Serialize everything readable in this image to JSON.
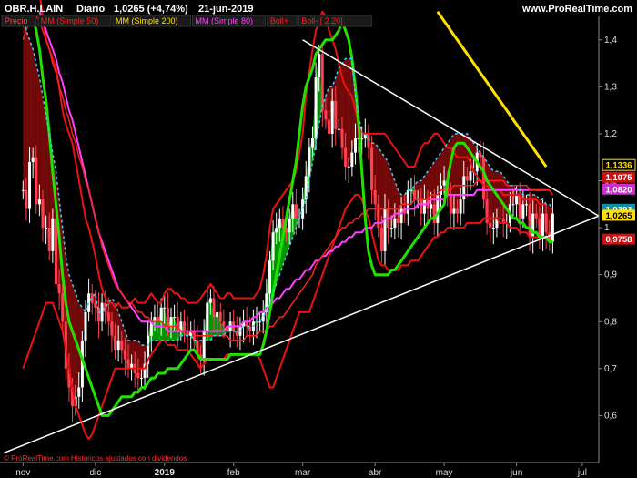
{
  "header": {
    "symbol": "OBR.H.LAIN",
    "period": "Diario",
    "price_change": "1,0265 (+4,74%)",
    "date": "21-jun-2019",
    "site": "www.ProRealTime.com"
  },
  "legend": [
    {
      "label": "Precio",
      "color": "#ff4040",
      "bg": "#1a1a1a"
    },
    {
      "label": "MM (Simple 50)",
      "color": "#ff2020",
      "bg": "#1a1a1a"
    },
    {
      "label": "MM (Simple 200)",
      "color": "#ffe000",
      "bg": "#1a1a1a"
    },
    {
      "label": "MM (Simple 80)",
      "color": "#ff40ff",
      "bg": "#1a1a1a"
    },
    {
      "label": "Boll+",
      "color": "#ff2020",
      "bg": "#1a1a1a"
    },
    {
      "label": "Boll-  [ 2.20]",
      "color": "#ff2020",
      "bg": "#1a1a1a"
    }
  ],
  "footer": "© ProRealTime.com  Históricos ajustados con dividendos",
  "colors": {
    "background": "#000000",
    "up_candle": "#ffffff",
    "down_candle": "#ff4050",
    "sar": "#39d0ff",
    "boll": "#ee1111",
    "ma50": "#ff2020",
    "ma200": "#ffe000",
    "ma80": "#ff40ff",
    "bull_cloud": "#00a000",
    "bear_cloud": "#7a0a0a",
    "green_line": "#22e000",
    "trendline": "#ffffff"
  },
  "price_badges": [
    {
      "value": "1,1336",
      "bg": "#000000",
      "fg": "#ffe000",
      "border": "#ffe000"
    },
    {
      "value": "1,1075",
      "bg": "#cc1010",
      "fg": "#ffffff"
    },
    {
      "value": "1,0820",
      "bg": "#cc30cc",
      "fg": "#ffffff"
    },
    {
      "value": "1,0393",
      "bg": "#1090a0",
      "fg": "#ffffff"
    },
    {
      "value": "1,0265",
      "bg": "#ffe000",
      "fg": "#000000"
    },
    {
      "value": "0,9758",
      "bg": "#cc1010",
      "fg": "#ffffff"
    }
  ],
  "chart_data": {
    "type": "line",
    "title": "",
    "ylim": [
      0.5,
      1.45
    ],
    "y_ticks": [
      "1,4",
      "1,3",
      "1,2",
      "1,1",
      "1",
      "0,9",
      "0,8",
      "0,7",
      "0,6"
    ],
    "y_tick_values": [
      1.4,
      1.3,
      1.2,
      1.1,
      1.0,
      0.9,
      0.8,
      0.7,
      0.6
    ],
    "x_ticks": [
      "nov",
      "dic",
      "2019",
      "feb",
      "mar",
      "abr",
      "may",
      "jun",
      "jul"
    ],
    "x_tick_values": [
      0,
      22,
      43,
      64,
      85,
      107,
      128,
      150,
      170
    ],
    "xlim": [
      -7,
      175
    ],
    "grid": false,
    "close": [
      1.08,
      1.04,
      1.14,
      1.15,
      1.05,
      1.06,
      1.0,
      1.0,
      0.95,
      1.02,
      0.88,
      0.86,
      0.8,
      0.7,
      0.66,
      0.62,
      0.64,
      0.66,
      0.76,
      0.82,
      0.86,
      0.84,
      0.83,
      0.8,
      0.84,
      0.82,
      0.8,
      0.77,
      0.74,
      0.76,
      0.74,
      0.72,
      0.7,
      0.71,
      0.69,
      0.68,
      0.68,
      0.71,
      0.77,
      0.8,
      0.81,
      0.8,
      0.83,
      0.83,
      0.79,
      0.81,
      0.81,
      0.78,
      0.8,
      0.78,
      0.77,
      0.78,
      0.76,
      0.73,
      0.72,
      0.78,
      0.84,
      0.85,
      0.81,
      0.82,
      0.8,
      0.79,
      0.78,
      0.8,
      0.78,
      0.77,
      0.79,
      0.8,
      0.79,
      0.78,
      0.8,
      0.8,
      0.8,
      0.82,
      0.86,
      0.93,
      0.99,
      1.0,
      1.02,
      1.0,
      0.99,
      1.02,
      1.05,
      1.02,
      1.02,
      1.06,
      1.11,
      1.17,
      1.19,
      1.32,
      1.37,
      1.25,
      1.23,
      1.2,
      1.27,
      1.21,
      1.21,
      1.17,
      1.13,
      1.13,
      1.16,
      1.19,
      1.19,
      1.19,
      1.2,
      1.17,
      1.08,
      1.05,
      1.0,
      0.95,
      1.04,
      1.0,
      1.0,
      1.02,
      1.01,
      1.04,
      1.03,
      1.08,
      1.08,
      1.06,
      1.06,
      1.03,
      1.06,
      1.04,
      1.05,
      1.01,
      1.07,
      1.09,
      1.1,
      1.07,
      1.03,
      1.04,
      1.03,
      1.06,
      1.11,
      1.1,
      1.12,
      1.12,
      1.16,
      1.15,
      1.06,
      1.01,
      1.0,
      1.0,
      1.02,
      1.02,
      1.01,
      1.01,
      1.05,
      1.05,
      1.07,
      1.02,
      1.05,
      1.05,
      0.98,
      1.03,
      1.02,
      0.98,
      1.03,
      0.99,
      0.97,
      1.03
    ],
    "ma50": [
      1.4,
      1.42,
      1.44,
      1.45,
      1.45,
      1.44,
      1.42,
      1.4,
      1.38,
      1.35,
      1.33,
      1.3,
      1.28,
      1.25,
      1.23,
      1.2,
      1.18,
      1.15,
      1.13,
      1.1,
      1.08,
      1.05,
      1.02,
      0.99,
      0.96,
      0.94,
      0.92,
      0.9,
      0.88,
      0.87,
      0.86,
      0.85,
      0.84,
      0.84,
      0.83,
      0.82,
      0.82,
      0.81,
      0.81,
      0.8,
      0.8,
      0.8,
      0.8,
      0.79,
      0.79,
      0.79,
      0.79,
      0.79,
      0.78,
      0.78,
      0.78,
      0.78,
      0.77,
      0.77,
      0.77,
      0.77,
      0.77,
      0.77,
      0.77,
      0.77,
      0.77,
      0.77,
      0.77,
      0.76,
      0.76,
      0.76,
      0.76,
      0.76,
      0.77,
      0.77,
      0.77,
      0.77,
      0.78,
      0.78,
      0.78,
      0.79,
      0.79,
      0.8,
      0.81,
      0.81,
      0.82,
      0.83,
      0.84,
      0.85,
      0.86,
      0.87,
      0.88,
      0.89,
      0.9,
      0.92,
      0.93,
      0.94,
      0.95,
      0.96,
      0.97,
      0.98,
      0.99,
      1.0,
      1.0,
      1.01,
      1.01,
      1.02,
      1.02,
      1.03,
      1.03,
      1.04,
      1.04,
      1.04,
      1.04,
      1.04,
      1.04,
      1.04,
      1.04,
      1.04,
      1.04,
      1.05,
      1.05,
      1.05,
      1.05,
      1.06,
      1.06,
      1.06,
      1.06,
      1.06,
      1.07,
      1.07,
      1.07,
      1.08,
      1.08,
      1.08,
      1.08,
      1.09,
      1.09,
      1.09,
      1.09,
      1.09,
      1.09,
      1.09,
      1.1,
      1.1,
      1.1,
      1.1,
      1.1,
      1.1,
      1.1,
      1.1,
      1.1,
      1.09,
      1.09,
      1.09,
      1.09,
      1.09,
      1.09,
      1.09,
      1.08,
      1.08,
      1.08,
      1.08,
      1.08,
      1.08,
      1.08,
      1.07
    ],
    "ma200": [
      null,
      null,
      null,
      null,
      null,
      null,
      null,
      null,
      null,
      null,
      null,
      null,
      null,
      null,
      null,
      null,
      null,
      null,
      null,
      null,
      null,
      null,
      null,
      null,
      null,
      null,
      null,
      null,
      null,
      null,
      null,
      null,
      null,
      null,
      null,
      null,
      null,
      null,
      null,
      null,
      null,
      null,
      null,
      null,
      null,
      null,
      null,
      null,
      null,
      null,
      null,
      null,
      null,
      null,
      null,
      null,
      null,
      null,
      null,
      null,
      null,
      null,
      null,
      null,
      null,
      null,
      null,
      null,
      null,
      null,
      null,
      null,
      null,
      null,
      null,
      null,
      null,
      null,
      null,
      null,
      null,
      null,
      null,
      null,
      null,
      null,
      null,
      null,
      null,
      null,
      null,
      null,
      null,
      null,
      null,
      null,
      null,
      null,
      null,
      null,
      null,
      null,
      null,
      null,
      null,
      null,
      null,
      null,
      null,
      null,
      null,
      null,
      null,
      null,
      null,
      null,
      null,
      null,
      null,
      null,
      null,
      null,
      null,
      null,
      null,
      null,
      1.46,
      1.45,
      1.44,
      1.43,
      1.42,
      1.41,
      1.4,
      1.39,
      1.38,
      1.37,
      1.36,
      1.35,
      1.34,
      1.33,
      1.32,
      1.31,
      1.3,
      1.29,
      1.28,
      1.27,
      1.26,
      1.25,
      1.24,
      1.23,
      1.22,
      1.21,
      1.2,
      1.19,
      1.18,
      1.17,
      1.16,
      1.15,
      1.14,
      1.13
    ],
    "ma80": [
      null,
      null,
      null,
      null,
      null,
      1.46,
      1.44,
      1.42,
      1.4,
      1.38,
      1.36,
      1.33,
      1.31,
      1.28,
      1.25,
      1.23,
      1.2,
      1.17,
      1.14,
      1.11,
      1.08,
      1.05,
      1.02,
      0.99,
      0.97,
      0.95,
      0.93,
      0.91,
      0.89,
      0.87,
      0.86,
      0.85,
      0.84,
      0.83,
      0.82,
      0.81,
      0.8,
      0.8,
      0.8,
      0.8,
      0.79,
      0.79,
      0.79,
      0.79,
      0.78,
      0.78,
      0.78,
      0.78,
      0.78,
      0.78,
      0.78,
      0.78,
      0.78,
      0.78,
      0.78,
      0.78,
      0.78,
      0.78,
      0.78,
      0.78,
      0.78,
      0.78,
      0.79,
      0.79,
      0.79,
      0.79,
      0.79,
      0.8,
      0.8,
      0.8,
      0.81,
      0.81,
      0.82,
      0.82,
      0.83,
      0.83,
      0.84,
      0.85,
      0.85,
      0.86,
      0.87,
      0.87,
      0.88,
      0.89,
      0.89,
      0.9,
      0.91,
      0.91,
      0.92,
      0.93,
      0.93,
      0.94,
      0.94,
      0.95,
      0.95,
      0.96,
      0.96,
      0.97,
      0.97,
      0.98,
      0.98,
      0.99,
      0.99,
      0.99,
      1.0,
      1.0,
      1.0,
      1.01,
      1.01,
      1.01,
      1.02,
      1.02,
      1.02,
      1.03,
      1.03,
      1.03,
      1.04,
      1.04,
      1.04,
      1.04,
      1.05,
      1.05,
      1.05,
      1.05,
      1.06,
      1.06,
      1.06,
      1.06,
      1.06,
      1.07,
      1.07,
      1.07,
      1.07,
      1.07,
      1.07,
      1.07,
      1.07,
      1.07,
      1.08,
      1.08,
      1.08,
      1.08,
      1.08,
      1.08,
      1.08,
      1.08,
      1.08,
      1.08,
      1.08,
      1.08,
      1.08,
      1.08,
      1.08,
      1.08,
      1.08,
      1.08,
      1.08,
      1.08,
      1.08,
      1.08
    ],
    "boll_upper": [
      1.6,
      1.6,
      1.6,
      1.6,
      1.56,
      1.5,
      1.45,
      1.4,
      1.38,
      1.36,
      1.34,
      1.3,
      1.25,
      1.22,
      1.2,
      1.18,
      1.14,
      1.1,
      1.06,
      1.02,
      1.0,
      0.97,
      0.94,
      0.9,
      0.87,
      0.85,
      0.84,
      0.84,
      0.83,
      0.84,
      0.83,
      0.83,
      0.83,
      0.84,
      0.85,
      0.84,
      0.84,
      0.84,
      0.85,
      0.86,
      0.85,
      0.84,
      0.84,
      0.86,
      0.87,
      0.87,
      0.86,
      0.86,
      0.85,
      0.85,
      0.84,
      0.84,
      0.84,
      0.84,
      0.85,
      0.86,
      0.87,
      0.88,
      0.87,
      0.86,
      0.85,
      0.85,
      0.86,
      0.86,
      0.85,
      0.85,
      0.85,
      0.85,
      0.85,
      0.85,
      0.85,
      0.86,
      0.87,
      0.9,
      0.94,
      1.0,
      1.04,
      1.05,
      1.06,
      1.07,
      1.08,
      1.09,
      1.1,
      1.12,
      1.16,
      1.2,
      1.28,
      1.33,
      1.38,
      1.42,
      1.44,
      1.46,
      1.45,
      1.42,
      1.4,
      1.38,
      1.35,
      1.32,
      1.3,
      1.29,
      1.28,
      1.25,
      1.22,
      1.2,
      1.2,
      1.2,
      1.2,
      1.2,
      1.2,
      1.2,
      1.2,
      1.19,
      1.18,
      1.17,
      1.16,
      1.15,
      1.14,
      1.13,
      1.13,
      1.13,
      1.15,
      1.17,
      1.18,
      1.18,
      1.19,
      1.2,
      1.2,
      1.19,
      1.18,
      1.17,
      1.17,
      1.16,
      1.15,
      1.15,
      1.15,
      1.15,
      1.14,
      1.12,
      1.11,
      1.1,
      1.09,
      1.09,
      1.08,
      1.08,
      1.08,
      1.08,
      1.07,
      1.07,
      1.07,
      1.07,
      1.07,
      1.07,
      1.06,
      1.06,
      1.06,
      1.06,
      1.06,
      1.05,
      1.05,
      1.05
    ],
    "boll_lower": [
      0.7,
      0.72,
      0.74,
      0.76,
      0.78,
      0.8,
      0.82,
      0.84,
      0.84,
      0.84,
      0.82,
      0.8,
      0.78,
      0.74,
      0.7,
      0.66,
      0.62,
      0.6,
      0.58,
      0.56,
      0.55,
      0.56,
      0.58,
      0.6,
      0.62,
      0.64,
      0.66,
      0.68,
      0.7,
      0.7,
      0.7,
      0.7,
      0.7,
      0.7,
      0.7,
      0.7,
      0.7,
      0.7,
      0.72,
      0.73,
      0.74,
      0.75,
      0.76,
      0.76,
      0.75,
      0.75,
      0.75,
      0.74,
      0.74,
      0.74,
      0.74,
      0.73,
      0.72,
      0.71,
      0.7,
      0.71,
      0.72,
      0.72,
      0.72,
      0.72,
      0.72,
      0.72,
      0.73,
      0.73,
      0.73,
      0.73,
      0.73,
      0.73,
      0.73,
      0.73,
      0.73,
      0.73,
      0.72,
      0.7,
      0.68,
      0.66,
      0.66,
      0.68,
      0.7,
      0.72,
      0.74,
      0.76,
      0.78,
      0.8,
      0.82,
      0.82,
      0.82,
      0.82,
      0.84,
      0.86,
      0.88,
      0.9,
      0.92,
      0.94,
      0.96,
      0.98,
      1.0,
      1.02,
      1.04,
      1.05,
      1.06,
      1.07,
      1.07,
      1.06,
      1.04,
      1.02,
      0.99,
      0.96,
      0.93,
      0.92,
      0.92,
      0.91,
      0.91,
      0.91,
      0.91,
      0.92,
      0.92,
      0.92,
      0.93,
      0.93,
      0.93,
      0.94,
      0.95,
      0.96,
      0.97,
      0.98,
      0.98,
      0.99,
      0.99,
      1.0,
      1.0,
      1.0,
      1.0,
      1.0,
      1.0,
      1.01,
      1.01,
      1.01,
      1.01,
      1.01,
      1.02,
      1.02,
      1.02,
      1.02,
      1.02,
      1.01,
      1.01,
      1.01,
      1.0,
      1.0,
      1.0,
      0.99,
      0.99,
      0.99,
      0.98,
      0.98,
      0.98,
      0.98
    ],
    "sar": [
      1.45,
      1.42,
      1.4,
      1.38,
      1.35,
      1.32,
      1.28,
      1.24,
      1.2,
      1.16,
      1.12,
      1.06,
      1.0,
      0.94,
      0.9,
      0.88,
      0.86,
      0.84,
      0.83,
      0.82,
      0.84,
      0.85,
      0.86,
      0.82,
      0.82,
      0.83,
      0.84,
      0.85,
      0.84,
      0.82,
      0.8,
      0.78,
      0.76,
      0.76,
      0.76,
      0.76,
      0.75,
      0.75,
      0.75,
      0.76,
      0.76,
      0.76,
      0.76,
      0.76,
      0.76,
      0.76,
      0.76,
      0.76,
      0.77,
      0.77,
      0.77,
      0.77,
      0.76,
      0.76,
      0.76,
      0.76,
      0.76,
      0.76,
      0.77,
      0.77,
      0.77,
      0.77,
      0.78,
      0.78,
      0.78,
      0.78,
      0.78,
      0.79,
      0.79,
      0.79,
      0.79,
      0.8,
      0.8,
      0.81,
      0.82,
      0.84,
      0.86,
      0.88,
      0.9,
      0.92,
      0.94,
      0.96,
      0.98,
      1.0,
      1.02,
      1.04,
      1.06,
      1.1,
      1.14,
      1.18,
      1.22,
      1.26,
      1.28,
      1.3,
      1.3,
      1.32,
      1.34,
      1.35,
      1.36,
      1.36,
      1.36,
      1.28,
      1.24,
      1.2,
      1.2,
      1.19,
      1.18,
      1.18,
      1.17,
      1.16,
      1.15,
      1.14,
      1.12,
      1.1,
      1.08,
      1.07,
      1.07,
      1.08,
      1.08,
      1.09,
      1.1,
      1.1,
      1.11,
      1.12,
      1.13,
      1.14,
      1.15,
      1.16,
      1.17,
      1.18,
      1.19,
      1.2,
      1.2,
      1.2,
      1.2,
      1.2,
      1.19,
      1.18,
      1.17,
      1.16,
      1.15,
      1.14,
      1.13,
      1.12,
      1.12,
      1.12,
      1.11,
      1.1,
      1.09,
      1.09,
      1.08,
      1.08,
      1.07,
      1.07,
      1.07,
      1.07,
      1.07,
      1.06,
      1.06,
      1.05,
      1.05,
      1.04
    ],
    "green_line": [
      null,
      null,
      null,
      1.45,
      1.42,
      1.38,
      1.32,
      1.27,
      1.2,
      1.12,
      1.05,
      0.98,
      0.9,
      0.84,
      0.8,
      0.78,
      0.76,
      0.74,
      0.72,
      0.7,
      0.68,
      0.66,
      0.64,
      0.62,
      0.6,
      0.6,
      0.6,
      0.61,
      0.62,
      0.63,
      0.64,
      0.64,
      0.64,
      0.64,
      0.65,
      0.65,
      0.66,
      0.66,
      0.67,
      0.68,
      0.68,
      0.69,
      0.69,
      0.69,
      0.7,
      0.7,
      0.7,
      0.7,
      0.71,
      0.72,
      0.73,
      0.74,
      0.74,
      0.73,
      0.72,
      0.72,
      0.72,
      0.72,
      0.72,
      0.72,
      0.72,
      0.72,
      0.72,
      0.73,
      0.73,
      0.73,
      0.73,
      0.73,
      0.73,
      0.73,
      0.73,
      0.73,
      0.73,
      0.75,
      0.78,
      0.82,
      0.86,
      0.9,
      0.94,
      0.98,
      1.02,
      1.06,
      1.1,
      1.14,
      1.2,
      1.26,
      1.3,
      1.32,
      1.34,
      1.37,
      1.38,
      1.39,
      1.4,
      1.4,
      1.4,
      1.41,
      1.42,
      1.44,
      1.42,
      1.4,
      1.36,
      1.3,
      1.22,
      1.12,
      1.02,
      0.95,
      0.92,
      0.9,
      0.9,
      0.9,
      0.9,
      0.9,
      0.91,
      0.91,
      0.92,
      0.93,
      0.94,
      0.95,
      0.96,
      0.97,
      0.98,
      0.99,
      1.0,
      1.01,
      1.02,
      1.02,
      1.03,
      1.04,
      1.05,
      1.1,
      1.14,
      1.17,
      1.18,
      1.18,
      1.18,
      1.17,
      1.16,
      1.15,
      1.14,
      1.13,
      1.12,
      1.1,
      1.09,
      1.08,
      1.07,
      1.06,
      1.05,
      1.04,
      1.03,
      1.02,
      1.02,
      1.01,
      1.01,
      1.0,
      1.0,
      0.99,
      0.99,
      0.98,
      0.98,
      0.98,
      0.97,
      0.97
    ],
    "trendlines": [
      {
        "x": [
          -6,
          175
        ],
        "y": [
          0.52,
          1.025
        ]
      },
      {
        "x": [
          85,
          175
        ],
        "y": [
          1.4,
          1.025
        ]
      }
    ]
  }
}
